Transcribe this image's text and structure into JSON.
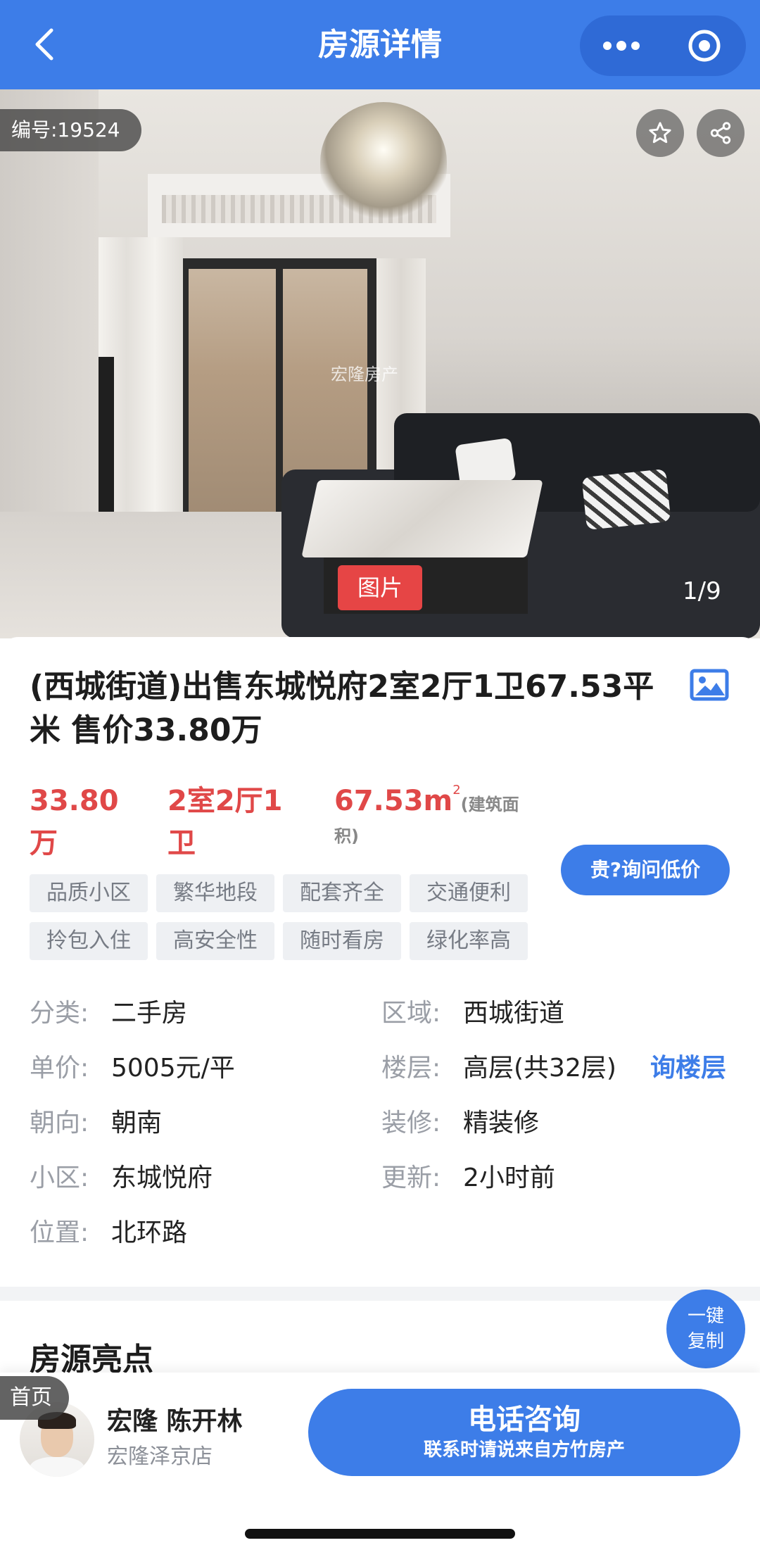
{
  "header": {
    "title": "房源详情",
    "colors": {
      "accent": "#3d7de8"
    }
  },
  "gallery": {
    "id_badge": "编号:19524",
    "tag": "图片",
    "counter": "1/9",
    "watermark": "宏隆房产"
  },
  "listing": {
    "title": "(西城街道)出售东城悦府2室2厅1卫67.53平米 售价33.80万",
    "price": "33.80万",
    "layout": "2室2厅1卫",
    "area_value": "67.53m",
    "area_sup": "2",
    "area_note": "(建筑面积)",
    "inquire_button": "贵?询问低价",
    "tags": [
      "品质小区",
      "繁华地段",
      "配套齐全",
      "交通便利",
      "拎包入住",
      "高安全性",
      "随时看房",
      "绿化率高"
    ]
  },
  "details": {
    "category_label": "分类:",
    "category_value": "二手房",
    "district_label": "区域:",
    "district_value": "西城街道",
    "unit_price_label": "单价:",
    "unit_price_value": "5005元/平",
    "floor_label": "楼层:",
    "floor_value": "高层(共32层)",
    "floor_link": "询楼层",
    "orientation_label": "朝向:",
    "orientation_value": "朝南",
    "decoration_label": "装修:",
    "decoration_value": "精装修",
    "community_label": "小区:",
    "community_value": "东城悦府",
    "updated_label": "更新:",
    "updated_value": "2小时前",
    "location_label": "位置:",
    "location_value": "北环路"
  },
  "highlights": {
    "title": "房源亮点",
    "copy_line1": "一键",
    "copy_line2": "复制"
  },
  "bottom": {
    "home_tab": "首页",
    "agent_name": "宏隆 陈开林",
    "agent_store": "宏隆泽京店",
    "call_main": "电话咨询",
    "call_sub": "联系时请说来自方竹房产"
  }
}
